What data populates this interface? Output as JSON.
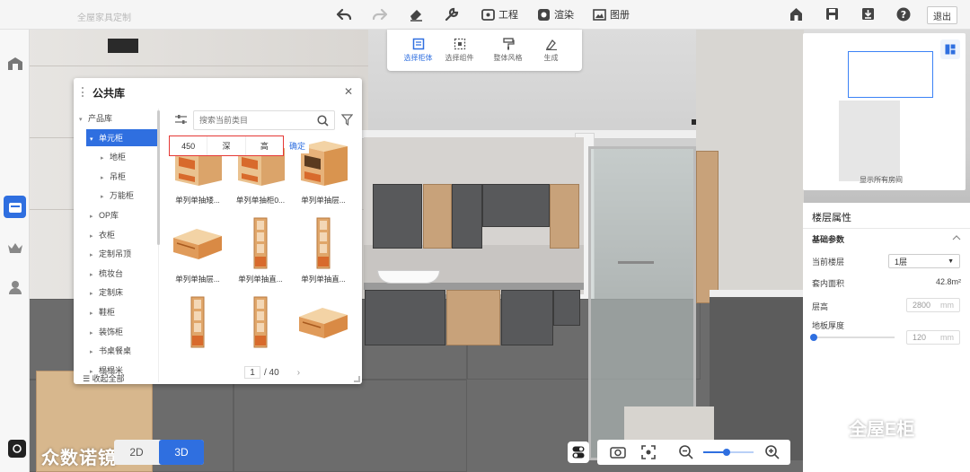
{
  "topbar": {
    "brand": "全屋家具定制",
    "project_label": "工程",
    "render_label": "渲染",
    "gallery_label": "图册",
    "exit_label": "退出"
  },
  "subtool": {
    "items": [
      {
        "label": "选择柜体",
        "active": true
      },
      {
        "label": "选择组件",
        "active": false
      },
      {
        "label": "整体风格",
        "active": false
      },
      {
        "label": "生成",
        "active": false
      }
    ]
  },
  "library": {
    "title": "公共库",
    "search_placeholder": "搜索当前类目",
    "dims": {
      "width": "450",
      "depth": "深",
      "height": "高"
    },
    "confirm_label": "确定",
    "tree": [
      {
        "label": "产品库",
        "level": 0,
        "arrow": "▾"
      },
      {
        "label": "单元柜",
        "level": 1,
        "arrow": "▾",
        "selected": true
      },
      {
        "label": "地柜",
        "level": 2,
        "arrow": "▸"
      },
      {
        "label": "吊柜",
        "level": 2,
        "arrow": "▸"
      },
      {
        "label": "万能柜",
        "level": 2,
        "arrow": "▸"
      },
      {
        "label": "OP库",
        "level": 1,
        "arrow": "▸"
      },
      {
        "label": "衣柜",
        "level": 1,
        "arrow": "▸"
      },
      {
        "label": "定制吊顶",
        "level": 1,
        "arrow": "▸"
      },
      {
        "label": "梳妆台",
        "level": 1,
        "arrow": "▸"
      },
      {
        "label": "定制床",
        "level": 1,
        "arrow": "▸"
      },
      {
        "label": "鞋柜",
        "level": 1,
        "arrow": "▸"
      },
      {
        "label": "装饰柜",
        "level": 1,
        "arrow": "▸"
      },
      {
        "label": "书桌餐桌",
        "level": 1,
        "arrow": "▸"
      },
      {
        "label": "榻榻米",
        "level": 1,
        "arrow": "▸"
      }
    ],
    "collapse_all": "收起全部",
    "products": [
      {
        "name": "单列单抽矮...",
        "kind": "drawer-open"
      },
      {
        "name": "单列单抽柜0...",
        "kind": "drawer-open"
      },
      {
        "name": "单列单抽层...",
        "kind": "drawer-shelf"
      },
      {
        "name": "单列单抽层...",
        "kind": "drawer-low"
      },
      {
        "name": "单列单抽直...",
        "kind": "tall-shelf"
      },
      {
        "name": "单列单抽直...",
        "kind": "tall-shelf"
      },
      {
        "name": "",
        "kind": "tall-shelf"
      },
      {
        "name": "",
        "kind": "tall-shelf"
      },
      {
        "name": "",
        "kind": "drawer-low"
      }
    ],
    "page_current": "1",
    "page_total": "/ 40"
  },
  "minimap": {
    "caption": "显示所有房间"
  },
  "properties": {
    "title": "楼层属性",
    "section": "基础参数",
    "floor_label": "当前楼层",
    "floor_value": "1层",
    "area_label": "套内面积",
    "area_value": "42.8m²",
    "height_label": "层高",
    "height_value": "2800",
    "thickness_label": "地板厚度",
    "thickness_value": "120",
    "unit": "mm"
  },
  "bottom": {
    "view_2d": "2D",
    "view_3d": "3D",
    "watermark": "众数诺镜",
    "brand_mark": "全屋E柜"
  },
  "colors": {
    "accent": "#2f6fe0",
    "highlight": "#e53935"
  }
}
